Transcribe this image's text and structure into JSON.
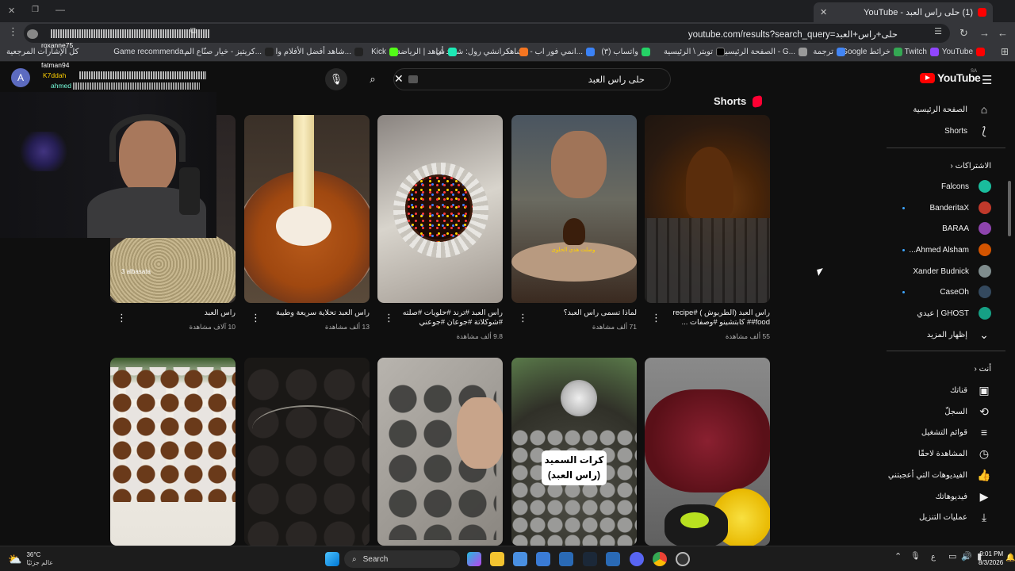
{
  "browser": {
    "tab_title": "(1) حلى راس العبد - YouTube",
    "url": "youtube.com/results?search_query=حلى+راس+العبد",
    "bookmarks": [
      "YouTube",
      "Twitch",
      "Google خرائط",
      "ترجمة",
      "الصفحة الرئيسية - G...",
      "تويتر \\ الرئيسية",
      "(٣) واتساب",
      "انمي فور اب - مشاهد...",
      "كرانشي رول: شاهد أن...",
      "شاهد | الرياضة",
      "Kick",
      "شاهد أفضل الأفلام وا...",
      "كريتيز - خيار صنّاع الم...",
      "Game recommenda...",
      "كل الإشارات المرجعية"
    ]
  },
  "youtube": {
    "logo_text": "YouTube",
    "logo_region": "SA",
    "search_value": "حلى راس العبد",
    "account_letter": "A",
    "sidebar": {
      "main": [
        "الصفحة الرئيسية",
        "Shorts"
      ],
      "subs_header": "الاشتراكات",
      "subs": [
        "Falcons",
        "BanderitaX",
        "BARAA",
        "Ahmed Alsham...",
        "Xander Budnick",
        "CaseOh",
        "GHOST | عيدي"
      ],
      "show_more": "إظهار المزيد",
      "you_header": "أنت",
      "you": [
        "قناتك",
        "السجلّ",
        "قوائم التشغيل",
        "المشاهدة لاحقًا",
        "الفيديوهات التي أعجبتني",
        "فيديوهاتك",
        "عمليات التنزيل"
      ]
    },
    "shorts_title": "Shorts",
    "shorts": [
      {
        "title": "راس العبد (الطربوش ) #recipe #food# كابتشينو #وصفات ...",
        "views": "55 ألف مشاهدة"
      },
      {
        "title": "لماذا تسمى راس العبد؟",
        "views": "71 ألف مشاهدة"
      },
      {
        "title": "رأس العبد #ترند #حلويات #صلته #شوكلاتة #جوعان #جوعني #الحرا...",
        "views": "9.8 ألف مشاهدة"
      },
      {
        "title": "راس العبد  تحلاية  سريعة وطيبة",
        "views": "13 ألف مشاهدة"
      },
      {
        "title": "راس العبد",
        "views": "10 آلاف مشاهدة"
      }
    ],
    "thumb_texts": {
      "thumb2_caption": "وصلت هذي الحلوى",
      "thumb5_watermark": "3 albasata",
      "row2_caption": "كرات السميد\n(راس العبد)"
    }
  },
  "stream": {
    "chat_lines": [
      "roxanne75",
      "fatman94",
      "K7ddah",
      "ahmed"
    ]
  },
  "taskbar": {
    "weather_temp": "36°C",
    "weather_text": "عالم جزئيًا",
    "search_label": "Search",
    "time": "9:01 PM",
    "date": "8/3/2026",
    "lang": "ع"
  }
}
